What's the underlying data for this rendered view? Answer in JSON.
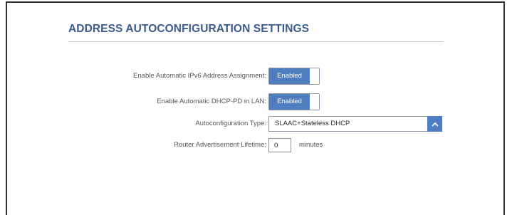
{
  "page": {
    "title": "ADDRESS AUTOCONFIGURATION SETTINGS"
  },
  "settings": {
    "auto_ipv6": {
      "label": "Enable Automatic IPv6 Address Assignment:",
      "state": "Enabled"
    },
    "auto_dhcp_pd": {
      "label": "Enable Automatic DHCP-PD in LAN:",
      "state": "Enabled"
    },
    "autoconfig_type": {
      "label": "Autoconfiguration Type:",
      "value": "SLAAC+Stateless DHCP",
      "icon": "chevron-up-icon"
    },
    "ra_lifetime": {
      "label": "Router Advertisement Lifetime:",
      "value": "0",
      "unit": "minutes"
    }
  },
  "colors": {
    "title": "#3a5a8c",
    "accent": "#4e7dc0",
    "border": "#8c95a3",
    "label": "#555555"
  }
}
